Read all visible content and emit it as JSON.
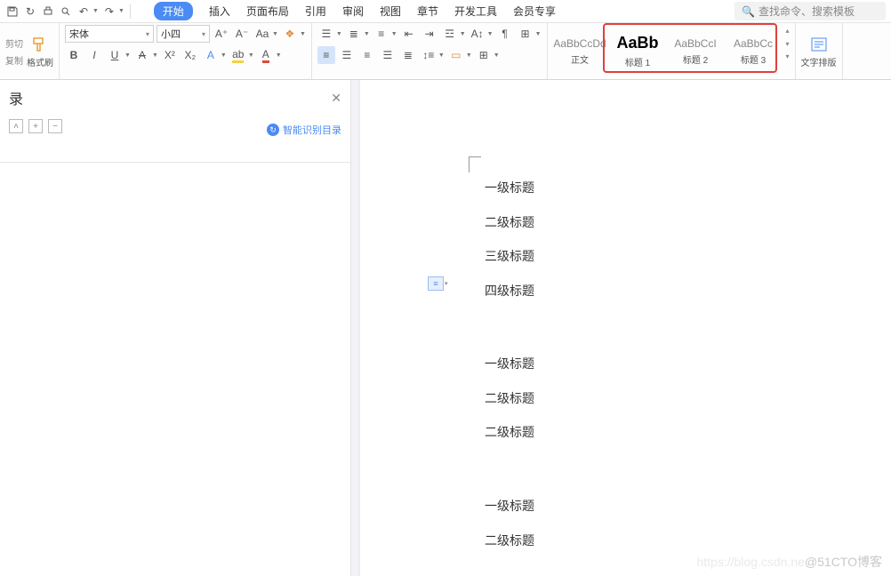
{
  "qat": {
    "search_placeholder": "查找命令、搜索模板"
  },
  "menu": {
    "start": "开始",
    "insert": "插入",
    "layout": "页面布局",
    "ref": "引用",
    "review": "审阅",
    "view": "视图",
    "chapter": "章节",
    "dev": "开发工具",
    "vip": "会员专享"
  },
  "clipboard": {
    "cut": "剪切",
    "copy": "复制",
    "fmt": "格式刷"
  },
  "font": {
    "name": "宋体",
    "size": "小四"
  },
  "styles": {
    "s0_preview": "AaBbCcDd",
    "s0_label": "正文",
    "s1_preview": "AaBb",
    "s1_label": "标题 1",
    "s2_preview": "AaBbCcI",
    "s2_label": "标题 2",
    "s3_preview": "AaBbCc",
    "s3_label": "标题 3"
  },
  "typeset": "文字排版",
  "sidebar": {
    "title": "录",
    "smart": "智能识别目录"
  },
  "doc": {
    "l1": "一级标题",
    "l2": "二级标题",
    "l3": "三级标题",
    "l4": "四级标题",
    "l5": "一级标题",
    "l6": "二级标题",
    "l7": "二级标题",
    "l8": "一级标题",
    "l9": "二级标题"
  },
  "watermark": {
    "faint": "https://blog.csdn.ne",
    "main": "@51CTO博客"
  }
}
